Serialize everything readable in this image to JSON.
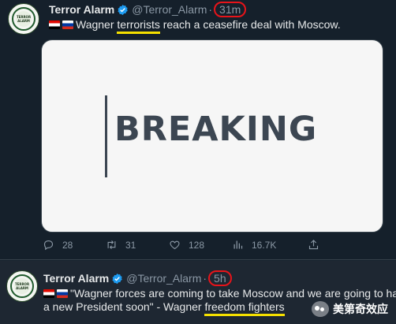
{
  "tweets": [
    {
      "author": {
        "name": "Terror Alarm",
        "handle": "@Terror_Alarm",
        "avatar_text": "TERROR ALARM"
      },
      "time": "31m",
      "body": {
        "prefix": "Wagner ",
        "highlight": "terrorists",
        "suffix": " reach a ceasefire deal with Moscow."
      },
      "media": {
        "text": "BREAKING"
      },
      "actions": {
        "replies": "28",
        "retweets": "31",
        "likes": "128",
        "views": "16.7K"
      }
    },
    {
      "author": {
        "name": "Terror Alarm",
        "handle": "@Terror_Alarm",
        "avatar_text": "TERROR ALARM"
      },
      "time": "5h",
      "body": {
        "line1": "\"Wagner forces are coming to take Moscow and we are going to have",
        "line2_prefix": "a new President soon\" -  Wagner ",
        "line2_highlight": "freedom fighters"
      }
    }
  ],
  "watermark": {
    "text": "美第奇效应"
  },
  "colors": {
    "background": "#15202b",
    "highlight": "#f5e000",
    "circle": "#e8141a",
    "verified": "#1d9bf0"
  }
}
